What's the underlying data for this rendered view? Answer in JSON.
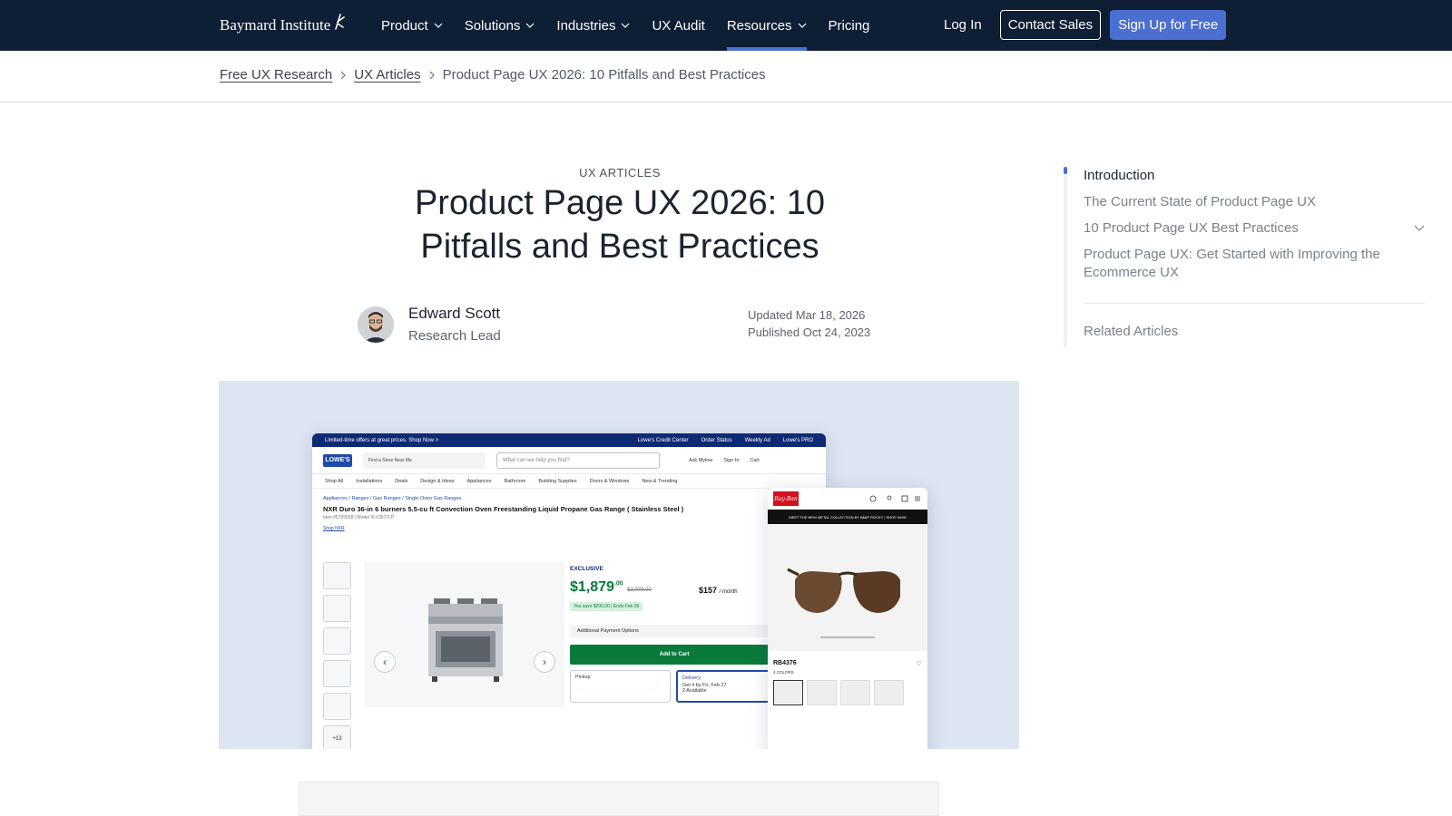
{
  "header": {
    "logo_text": "Baymard Institute",
    "nav": [
      {
        "label": "Product",
        "has_dropdown": true
      },
      {
        "label": "Solutions",
        "has_dropdown": true
      },
      {
        "label": "Industries",
        "has_dropdown": true
      },
      {
        "label": "UX Audit",
        "has_dropdown": false
      },
      {
        "label": "Resources",
        "has_dropdown": true,
        "active": true
      },
      {
        "label": "Pricing",
        "has_dropdown": false
      }
    ],
    "login_label": "Log In",
    "contact_label": "Contact Sales",
    "signup_label": "Sign Up for Free",
    "colors": {
      "bar": "#0e1e34",
      "accent": "#4a6fd0"
    }
  },
  "breadcrumb": {
    "items": [
      "Free UX Research",
      "UX Articles"
    ],
    "current": "Product Page UX 2026: 10 Pitfalls and Best Practices"
  },
  "article": {
    "eyebrow": "UX ARTICLES",
    "title_line1": "Product Page UX 2026: 10",
    "title_line2": "Pitfalls and Best Practices",
    "author": {
      "name": "Edward Scott",
      "role": "Research Lead"
    },
    "updated": "Updated Mar 18, 2026",
    "published": "Published Oct 24, 2023"
  },
  "hero": {
    "main_shot": {
      "announcement": "Limited-time offers at great prices. Shop Now >",
      "announcement_links": [
        "Lowe's Credit Center",
        "Order Status",
        "Weekly Ad",
        "Lowe's PRO"
      ],
      "logo": "LOWE'S",
      "store": "Find a Store Near Me",
      "search_placeholder": "What can we help you find?",
      "header_links": [
        "Ask Mylow",
        "Sign In",
        "Cart"
      ],
      "subnav": [
        "Shop All",
        "Installations",
        "Deals",
        "Design & Ideas",
        "Appliances",
        "Bathroom",
        "Building Supplies",
        "Doors & Windows",
        "New & Trending"
      ],
      "breadcrumb": "Appliances / Ranges / Gas Ranges / Single Oven Gas Ranges",
      "product_name": "NXR Duro 36-in 6 burners 5.5-cu ft Convection Oven Freestanding Liquid Propane Gas Range ( Stainless Steel )",
      "meta": "Item #5709568 | Model #LV3677LP",
      "shop_link": "Shop NXR",
      "more_thumbs": "+13",
      "exclusive": "EXCLUSIVE",
      "price": "$1,879",
      "price_cents": ".00",
      "price_was": "$2,079.00",
      "save": "You save $200.00 | Ends Feb 26",
      "monthly": "$157",
      "monthly_unit": "/ month",
      "additional_options": "Additional Payment Options",
      "add_to_cart": "Add to Cart",
      "pickup": "Pickup",
      "delivery": "Delivery",
      "delivery_detail": "Get it by Fri, Feb 27",
      "delivery_avail": "2 Available"
    },
    "mobile_shot": {
      "logo": "Ray-Ban",
      "banner": "MEET THE NEW METAL COLLECTION BY A$AP ROCKY | SHOP NOW",
      "sku": "RB4376",
      "colors_label": "4 COLORS"
    }
  },
  "toc": {
    "items": [
      {
        "label": "Introduction",
        "active": true
      },
      {
        "label": "The Current State of Product Page UX",
        "active": false
      },
      {
        "label": "10 Product Page UX Best Practices",
        "active": false,
        "expandable": true
      },
      {
        "label": "Product Page UX: Get Started with Improving the Ecommerce UX",
        "active": false
      }
    ],
    "related": "Related Articles"
  }
}
